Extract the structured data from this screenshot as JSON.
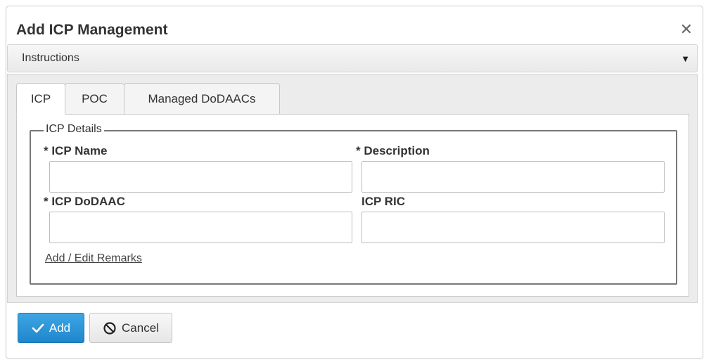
{
  "dialog": {
    "title": "Add ICP Management",
    "close_icon": "close-icon"
  },
  "instructions": {
    "label": "Instructions",
    "caret_icon": "caret-down-icon"
  },
  "tabs": [
    {
      "label": "ICP",
      "active": true
    },
    {
      "label": "POC",
      "active": false
    },
    {
      "label": "Managed DoDAACs",
      "active": false
    }
  ],
  "icp_details": {
    "legend": "ICP Details",
    "icp_name_label": "* ICP Name",
    "icp_name_value": "",
    "description_label": "* Description",
    "description_value": "",
    "icp_dodaac_label": "* ICP DoDAAC",
    "icp_dodaac_value": "",
    "icp_ric_label": "ICP RIC",
    "icp_ric_value": "",
    "remarks_link": "Add / Edit Remarks"
  },
  "footer": {
    "add_label": "Add",
    "add_icon": "checkmark-icon",
    "cancel_label": "Cancel",
    "cancel_icon": "cancel-circle-icon"
  },
  "colors": {
    "primary_button": "#2a95da",
    "panel_bg": "#ececec"
  }
}
